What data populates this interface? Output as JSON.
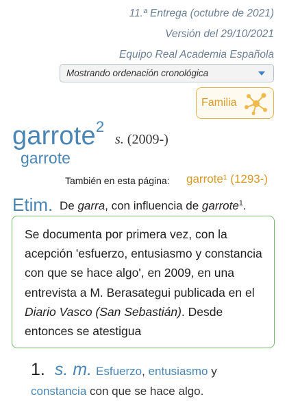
{
  "header": {
    "edition": "11.ª Entrega (octubre de 2021)",
    "version": "Versión del 29/10/2021",
    "team": "Equipo Real Academia Española"
  },
  "sort_select": {
    "value": "Mostrando ordenación cronológica"
  },
  "familia_button": {
    "label": "Familia"
  },
  "entry": {
    "lemma": "garrote",
    "homograph": "2",
    "pos": "s.",
    "date": "(2009-)",
    "variant": "garrote"
  },
  "also_on_page": {
    "label": "También en esta página:",
    "link_word": "garrote",
    "link_mark": "¹",
    "link_date": "(1293-)"
  },
  "etym": {
    "label": "Etim.",
    "prefix": "De ",
    "word1": "garra",
    "middle": ", con influencia de ",
    "word2": "garrote",
    "sup": "1",
    "suffix": "."
  },
  "note": {
    "part1": "Se documenta por primera vez, con la acepción 'esfuerzo, entusiasmo y constancia con que se hace algo', en 2009, en una entrevista a M. Berasategui publicada en el ",
    "source": "Diario Vasco (San Sebastián)",
    "part2": ". Desde entonces se atestigua"
  },
  "definition": {
    "number": "1.",
    "pos": "s. m.",
    "word1": "Esfuerzo",
    "sep1": ", ",
    "word2": "entusiasmo",
    "sep2": " y ",
    "word3": "constancia",
    "rest": " con que se hace algo."
  },
  "colors": {
    "accent_blue": "#4a86b5",
    "accent_orange": "#d89a25",
    "note_border": "#79b86e"
  }
}
